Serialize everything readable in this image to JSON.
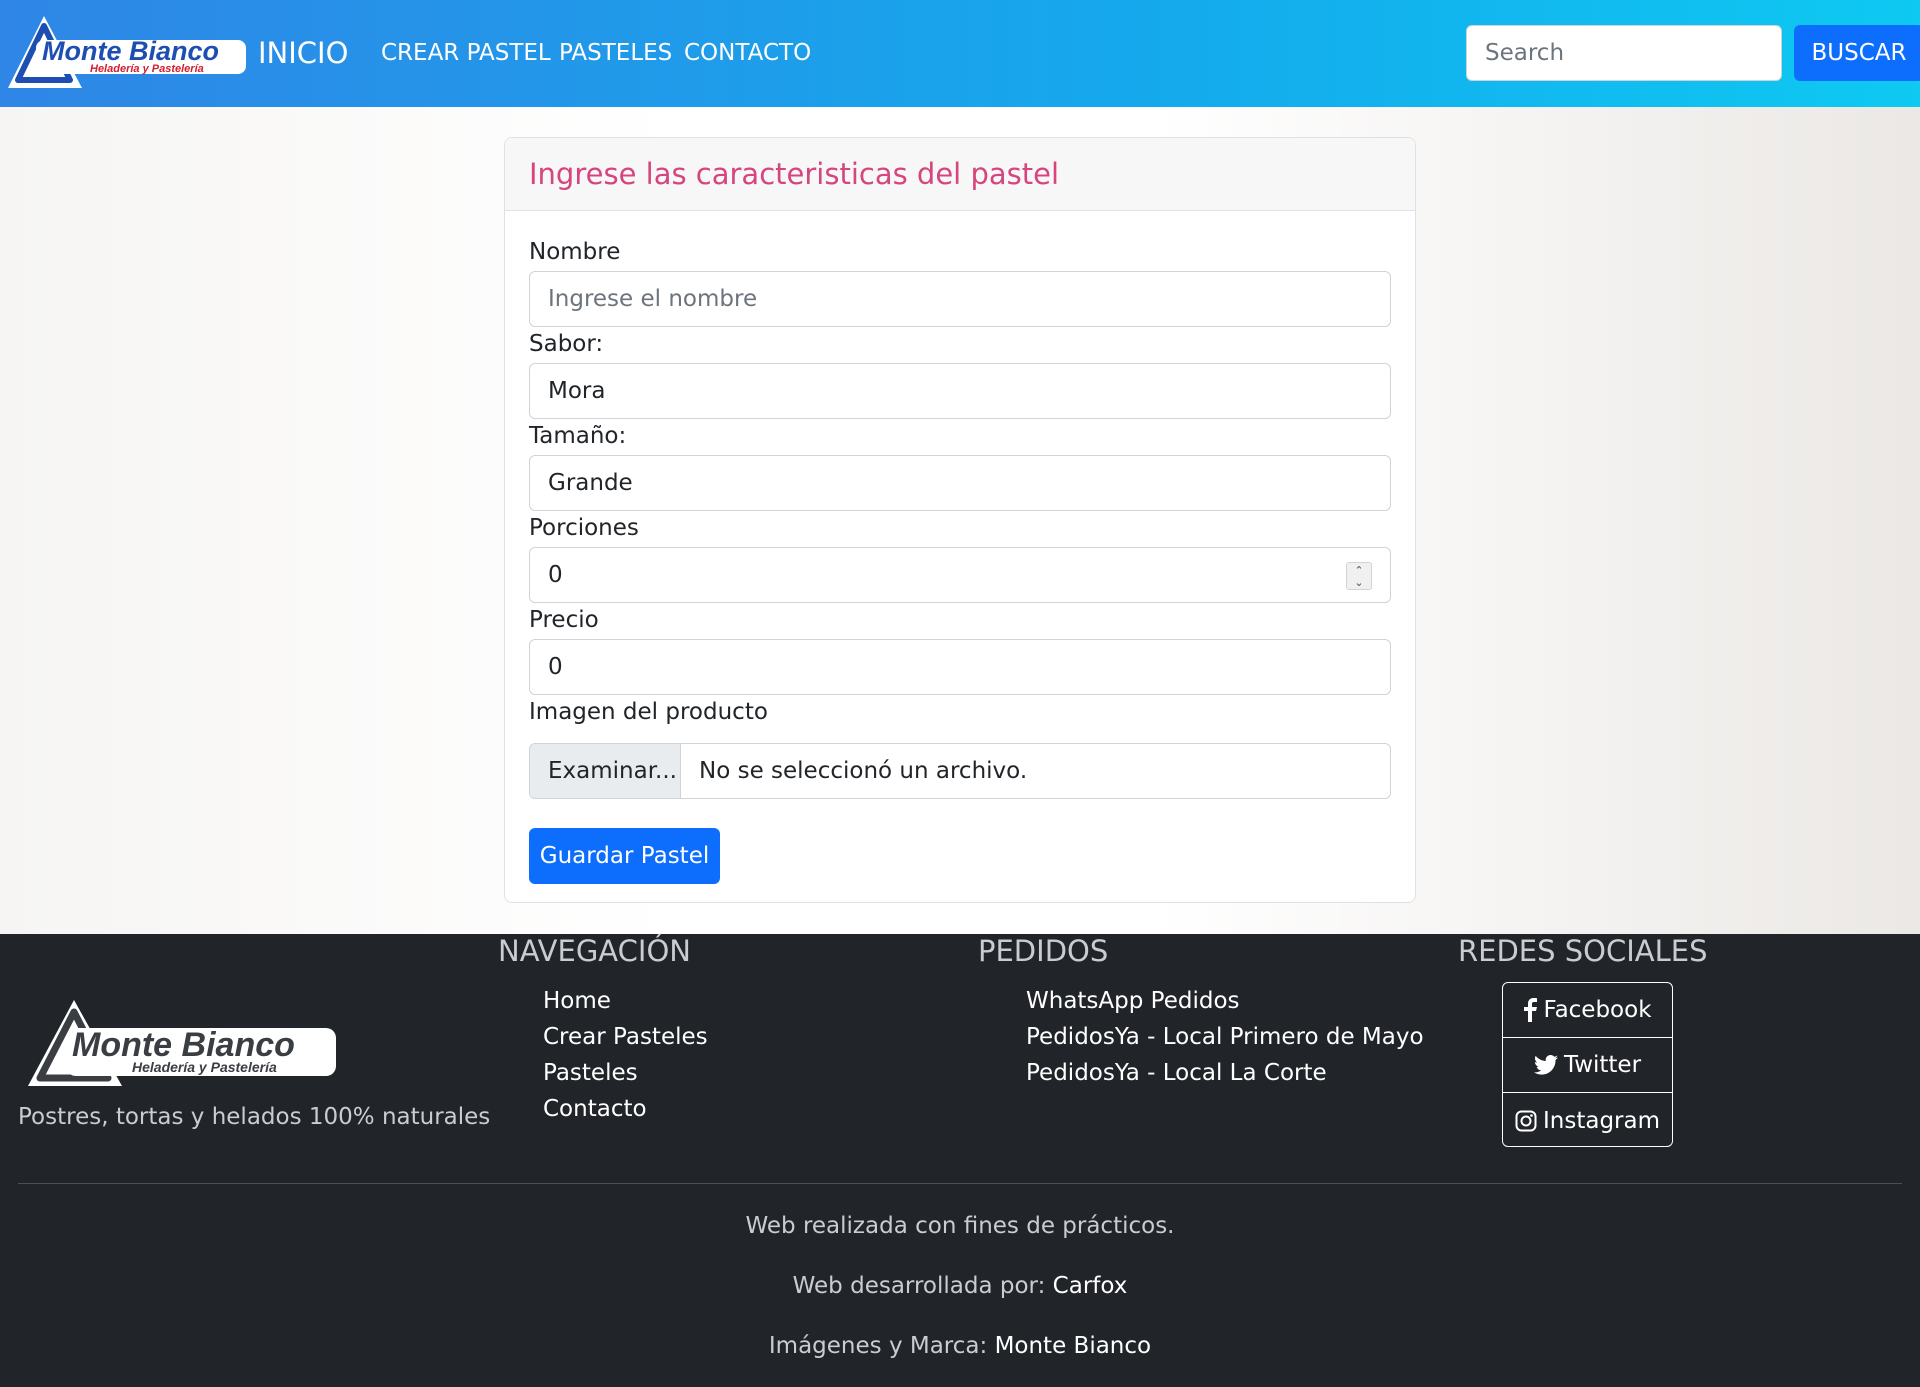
{
  "brand": {
    "name": "Monte Bianco",
    "subtitle": "Heladería y Pastelería"
  },
  "nav": {
    "home": "INICIO",
    "links": [
      "CREAR PASTEL",
      "PASTELES",
      "CONTACTO"
    ],
    "search_placeholder": "Search",
    "search_button": "BUSCAR"
  },
  "form": {
    "title": "Ingrese las caracteristicas del pastel",
    "nombre": {
      "label": "Nombre",
      "placeholder": "Ingrese el nombre",
      "value": ""
    },
    "sabor": {
      "label": "Sabor:",
      "value": "Mora"
    },
    "tamano": {
      "label": "Tamaño:",
      "value": "Grande"
    },
    "porciones": {
      "label": "Porciones",
      "value": "0"
    },
    "precio": {
      "label": "Precio",
      "value": "0"
    },
    "imagen": {
      "label": "Imagen del producto",
      "button": "Examinar...",
      "status": "No se seleccionó un archivo."
    },
    "submit": "Guardar Pastel"
  },
  "footer": {
    "tagline": "Postres, tortas y helados 100% naturales",
    "nav_heading": "NAVEGACIÓN",
    "nav_links": [
      "Home",
      "Crear Pasteles",
      "Pasteles",
      "Contacto"
    ],
    "orders_heading": "PEDIDOS",
    "orders_links": [
      "WhatsApp Pedidos",
      "PedidosYa - Local Primero de Mayo",
      "PedidosYa - Local La Corte"
    ],
    "social_heading": "REDES SOCIALES",
    "social": [
      {
        "label": "Facebook",
        "icon": "facebook-icon"
      },
      {
        "label": "Twitter",
        "icon": "twitter-icon"
      },
      {
        "label": "Instagram",
        "icon": "instagram-icon"
      }
    ],
    "credit1": "Web realizada con fines de prácticos.",
    "credit2_prefix": "Web desarrollada por:",
    "credit2_link": "Carfox",
    "credit3_prefix": "Imágenes y Marca:",
    "credit3_link": "Monte Bianco"
  },
  "colors": {
    "nav_start": "#2f86e6",
    "nav_end": "#0ec9f2",
    "primary": "#0d6efd",
    "title_pink": "#d6457d",
    "footer_bg": "#212529"
  }
}
